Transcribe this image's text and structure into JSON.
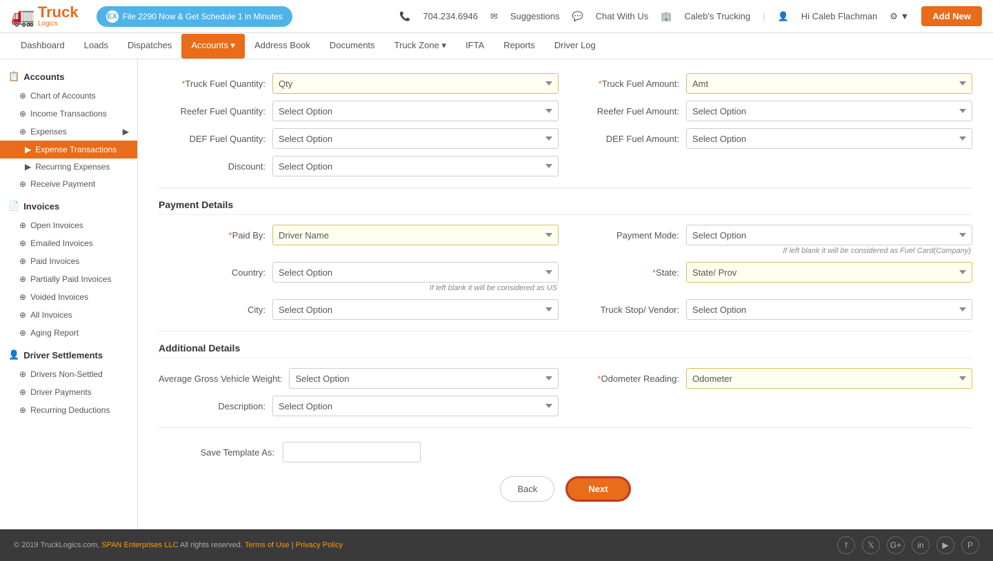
{
  "app": {
    "name": "TruckLogics",
    "tagline": "Logics"
  },
  "topBanner": {
    "promo": "File 2290 Now & Get Schedule 1 in Minutes",
    "phone": "704.234.6946",
    "suggestions": "Suggestions",
    "chat": "Chat With Us",
    "company": "Caleb's Trucking",
    "user": "Hi Caleb Flachman",
    "addNew": "Add New"
  },
  "nav": {
    "items": [
      {
        "label": "Dashboard",
        "active": false
      },
      {
        "label": "Loads",
        "active": false
      },
      {
        "label": "Dispatches",
        "active": false
      },
      {
        "label": "Accounts",
        "active": true,
        "hasDropdown": true
      },
      {
        "label": "Address Book",
        "active": false
      },
      {
        "label": "Documents",
        "active": false
      },
      {
        "label": "Truck Zone",
        "active": false,
        "hasDropdown": true
      },
      {
        "label": "IFTA",
        "active": false
      },
      {
        "label": "Reports",
        "active": false
      },
      {
        "label": "Driver Log",
        "active": false
      }
    ]
  },
  "sidebar": {
    "sections": [
      {
        "header": "Accounts",
        "items": [
          {
            "label": "Chart of Accounts",
            "icon": "⊕",
            "sub": false,
            "active": false
          },
          {
            "label": "Income Transactions",
            "icon": "⊕",
            "sub": false,
            "active": false
          },
          {
            "label": "Expenses",
            "icon": "⊕",
            "sub": false,
            "active": false,
            "hasArrow": true
          },
          {
            "label": "Expense Transactions",
            "sub": true,
            "active": true
          },
          {
            "label": "Recurring Expenses",
            "sub": true,
            "active": false
          },
          {
            "label": "Receive Payment",
            "icon": "⊕",
            "sub": false,
            "active": false
          }
        ]
      },
      {
        "header": "Invoices",
        "items": [
          {
            "label": "Open Invoices",
            "icon": "⊕",
            "sub": false,
            "active": false
          },
          {
            "label": "Emailed Invoices",
            "icon": "⊕",
            "sub": false,
            "active": false
          },
          {
            "label": "Paid Invoices",
            "icon": "⊕",
            "sub": false,
            "active": false
          },
          {
            "label": "Partially Paid Invoices",
            "icon": "⊕",
            "sub": false,
            "active": false
          },
          {
            "label": "Voided Invoices",
            "icon": "⊕",
            "sub": false,
            "active": false
          },
          {
            "label": "All Invoices",
            "icon": "⊕",
            "sub": false,
            "active": false
          },
          {
            "label": "Aging Report",
            "icon": "⊕",
            "sub": false,
            "active": false
          }
        ]
      },
      {
        "header": "Driver Settlements",
        "items": [
          {
            "label": "Drivers Non-Settled",
            "icon": "⊕",
            "sub": false,
            "active": false
          },
          {
            "label": "Driver Payments",
            "icon": "⊕",
            "sub": false,
            "active": false
          },
          {
            "label": "Recurring Deductions",
            "icon": "⊕",
            "sub": false,
            "active": false
          }
        ]
      }
    ]
  },
  "form": {
    "fuelSection": {
      "truckFuelQty": {
        "label": "*Truck Fuel Quantity:",
        "value": "Qty",
        "highlighted": true
      },
      "truckFuelAmt": {
        "label": "*Truck Fuel Amount:",
        "value": "Amt",
        "highlighted": true
      },
      "reeferFuelQty": {
        "label": "Reefer Fuel Quantity:",
        "value": "Select Option",
        "highlighted": false
      },
      "reeferFuelAmt": {
        "label": "Reefer Fuel Amount:",
        "value": "Select Option",
        "highlighted": false
      },
      "defFuelQty": {
        "label": "DEF Fuel Quantity:",
        "value": "Select Option",
        "highlighted": false
      },
      "defFuelAmt": {
        "label": "DEF Fuel Amount:",
        "value": "Select Option",
        "highlighted": false
      },
      "discount": {
        "label": "Discount:",
        "value": "Select Option",
        "highlighted": false
      }
    },
    "paymentSection": {
      "title": "Payment Details",
      "paidBy": {
        "label": "*Paid By:",
        "value": "Driver Name",
        "highlighted": true
      },
      "paymentMode": {
        "label": "Payment Mode:",
        "value": "Select Option",
        "highlighted": false
      },
      "paymentHint": "If left blank it will be considered as Fuel Card(Company)",
      "country": {
        "label": "Country:",
        "value": "Select Option",
        "highlighted": false
      },
      "countryHint": "If left blank it will be considered as US",
      "state": {
        "label": "*State:",
        "value": "State/ Prov",
        "highlighted": true
      },
      "city": {
        "label": "City:",
        "value": "Select Option",
        "highlighted": false
      },
      "truckStop": {
        "label": "Truck Stop/ Vendor:",
        "value": "Select Option",
        "highlighted": false
      }
    },
    "additionalSection": {
      "title": "Additional Details",
      "avgGrossWeight": {
        "label": "Average Gross Vehicle Weight:",
        "value": "Select Option",
        "highlighted": false
      },
      "odometerReading": {
        "label": "*Odometer Reading:",
        "value": "Odometer",
        "highlighted": true
      },
      "description": {
        "label": "Description:",
        "value": "Select Option",
        "highlighted": false
      }
    },
    "saveTemplate": {
      "label": "Save Template As:",
      "value": ""
    },
    "buttons": {
      "back": "Back",
      "next": "Next"
    }
  },
  "footer": {
    "copy": "© 2019 TruckLogics.com,",
    "company": "SPAN Enterprises LLC",
    "rights": "All rights reserved.",
    "terms": "Terms of Use",
    "privacy": "Privacy Policy"
  }
}
